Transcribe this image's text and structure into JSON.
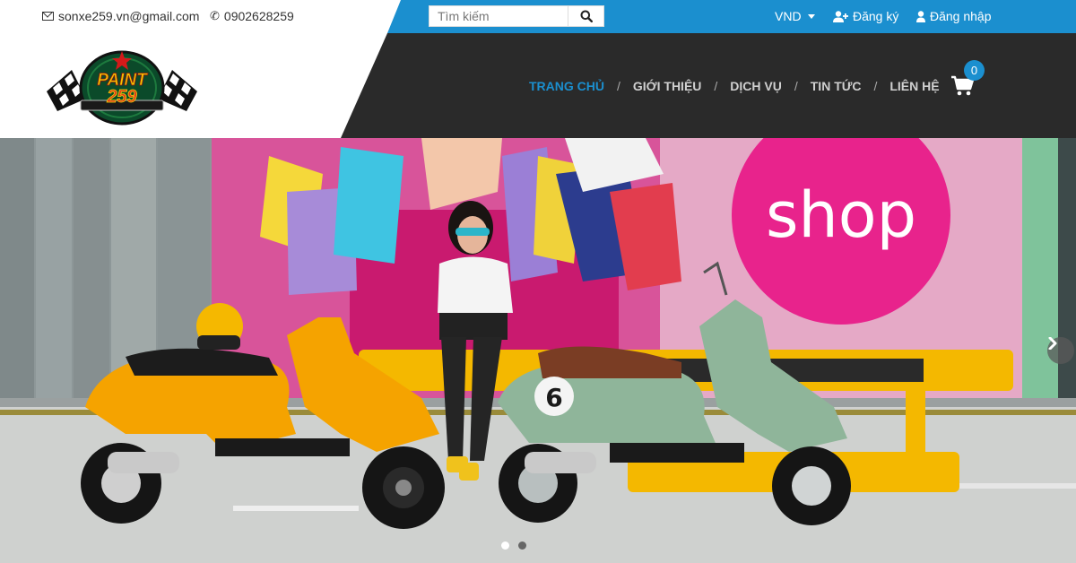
{
  "topbar": {
    "email": "sonxe259.vn@gmail.com",
    "phone": "0902628259",
    "search": {
      "placeholder": "Tìm kiếm"
    },
    "currency": "VND",
    "register_label": "Đăng ký",
    "login_label": "Đăng nhập"
  },
  "header": {
    "logo": {
      "line1": "PAINT",
      "line2": "259"
    },
    "nav": [
      {
        "label": "TRANG CHỦ",
        "active": true
      },
      {
        "label": "GIỚI THIỆU",
        "active": false
      },
      {
        "label": "DỊCH VỤ",
        "active": false
      },
      {
        "label": "TIN TỨC",
        "active": false
      },
      {
        "label": "LIÊN HỆ",
        "active": false
      }
    ],
    "separator": "/",
    "cart_count": "0"
  },
  "hero": {
    "billboard_text": "shop",
    "scooter_badge": "6",
    "slides_total": 2,
    "active_slide": 1
  },
  "colors": {
    "accent": "#1b8fcf",
    "header_dark": "#2a2a2a",
    "billboard_pink": "#e8238c",
    "scooter_yellow": "#f5a300",
    "scooter_green": "#8fb59a"
  }
}
